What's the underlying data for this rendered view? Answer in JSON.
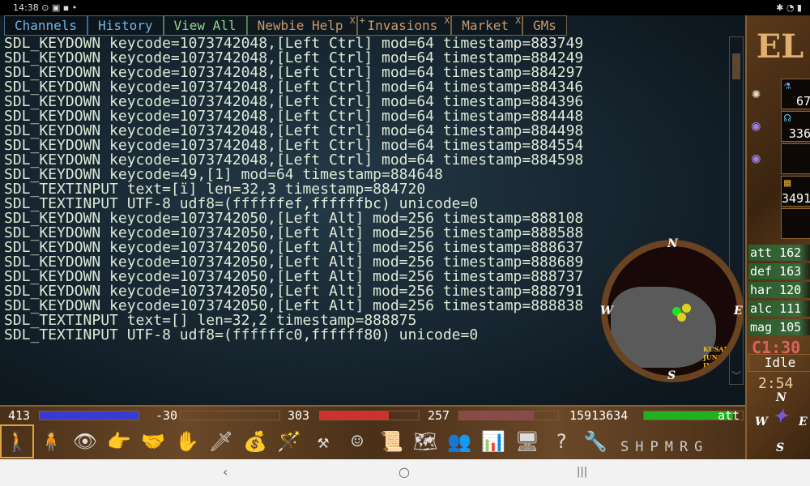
{
  "status_bar": {
    "time": "14:38",
    "icons_left": "⊙ ▣ ▪ •",
    "icons_right": "✱ ◔ ▮"
  },
  "tabs": [
    {
      "label": "Channels",
      "style": "blue"
    },
    {
      "label": "History",
      "style": "blue"
    },
    {
      "label": "View All",
      "style": "green"
    },
    {
      "label": "Newbie Help",
      "close": "X"
    },
    {
      "label": "Invasions",
      "close": "X",
      "plus": "+"
    },
    {
      "label": "Market",
      "close": "X"
    },
    {
      "label": "GMs"
    }
  ],
  "chat_lines": [
    "SDL_KEYDOWN keycode=1073742048,[Left Ctrl] mod=64 timestamp=883749",
    "SDL_KEYDOWN keycode=1073742048,[Left Ctrl] mod=64 timestamp=884249",
    "SDL_KEYDOWN keycode=1073742048,[Left Ctrl] mod=64 timestamp=884297",
    "SDL_KEYDOWN keycode=1073742048,[Left Ctrl] mod=64 timestamp=884346",
    "SDL_KEYDOWN keycode=1073742048,[Left Ctrl] mod=64 timestamp=884396",
    "SDL_KEYDOWN keycode=1073742048,[Left Ctrl] mod=64 timestamp=884448",
    "SDL_KEYDOWN keycode=1073742048,[Left Ctrl] mod=64 timestamp=884498",
    "SDL_KEYDOWN keycode=1073742048,[Left Ctrl] mod=64 timestamp=884554",
    "SDL_KEYDOWN keycode=1073742048,[Left Ctrl] mod=64 timestamp=884598",
    "SDL_KEYDOWN keycode=49,[1] mod=64 timestamp=884648",
    "SDL_TEXTINPUT text=[ï] len=32,3 timestamp=884720",
    "SDL_TEXTINPUT UTF-8 udf8=(ffffffef,ffffffbc) unicode=0",
    "SDL_KEYDOWN keycode=1073742050,[Left Alt] mod=256 timestamp=888108",
    "SDL_KEYDOWN keycode=1073742050,[Left Alt] mod=256 timestamp=888588",
    "SDL_KEYDOWN keycode=1073742050,[Left Alt] mod=256 timestamp=888637",
    "SDL_KEYDOWN keycode=1073742050,[Left Alt] mod=256 timestamp=888689",
    "SDL_KEYDOWN keycode=1073742050,[Left Alt] mod=256 timestamp=888737",
    "SDL_KEYDOWN keycode=1073742050,[Left Alt] mod=256 timestamp=888791",
    "SDL_KEYDOWN keycode=1073742050,[Left Alt] mod=256 timestamp=888838",
    "SDL_TEXTINPUT text=[] len=32,2 timestamp=888875",
    "SDL_TEXTINPUT UTF-8 udf8=(ffffffc0,ffffff80) unicode=0"
  ],
  "minimap": {
    "compass": {
      "n": "N",
      "s": "S",
      "e": "E",
      "w": "W"
    },
    "map_label": "KUSAMU\nJUNGLE\nINSU"
  },
  "side_panel": {
    "logo": "EL",
    "quickbar": [
      {
        "icon": "potion-icon",
        "count": "67"
      },
      {
        "icon": "essence-icon",
        "count": "336"
      },
      {
        "icon": "empty",
        "count": ""
      },
      {
        "icon": "gold-coins-icon",
        "count": "3491"
      },
      {
        "icon": "empty",
        "count": ""
      }
    ],
    "spells": [
      "summon-icon",
      "magic-orb-icon",
      "magic-orb-icon"
    ],
    "skills": [
      {
        "name": "att",
        "value": "162"
      },
      {
        "name": "def",
        "value": "163"
      },
      {
        "name": "har",
        "value": "120"
      },
      {
        "name": "alc",
        "value": "111"
      },
      {
        "name": "mag",
        "value": "105"
      }
    ],
    "server_clock": "C1:30",
    "action": "Idle",
    "time": "2:54",
    "compass": {
      "n": "N",
      "s": "S",
      "e": "E",
      "w": "W"
    }
  },
  "bottom_bar": {
    "stats": [
      {
        "value": "413",
        "color": "#3a3ad0",
        "fill": 1.0
      },
      {
        "value": "-30",
        "color": "#3a3ad0",
        "fill": 0.0
      },
      {
        "value": "303",
        "color": "#d03030",
        "fill": 0.7
      },
      {
        "value": "257",
        "color": "#8a4a4a",
        "fill": 0.75
      },
      {
        "value": "15913634",
        "color": "#20b020",
        "fill": 0.9,
        "label": "att"
      }
    ],
    "icons": [
      {
        "name": "walk-icon",
        "glyph": "🚶"
      },
      {
        "name": "sit-icon",
        "glyph": "🧍"
      },
      {
        "name": "look-icon",
        "glyph": "👁"
      },
      {
        "name": "use-icon",
        "glyph": "👉"
      },
      {
        "name": "trade-icon",
        "glyph": "🤝"
      },
      {
        "name": "attack-hand-icon",
        "glyph": "✋"
      },
      {
        "name": "sword-icon",
        "glyph": "🗡"
      },
      {
        "name": "inventory-bag-icon",
        "glyph": "💰"
      },
      {
        "name": "spells-wand-icon",
        "glyph": "🪄"
      },
      {
        "name": "manufacture-icon",
        "glyph": "⚒"
      },
      {
        "name": "emotes-icon",
        "glyph": "☺"
      },
      {
        "name": "quest-scroll-icon",
        "glyph": "📜"
      },
      {
        "name": "map-icon",
        "glyph": "🗺"
      },
      {
        "name": "buddy-icon",
        "glyph": "👥"
      },
      {
        "name": "stats-icon",
        "glyph": "📊"
      },
      {
        "name": "console-icon",
        "glyph": "🖥"
      },
      {
        "name": "help-icon",
        "glyph": "?"
      },
      {
        "name": "options-icon",
        "glyph": "🔧"
      }
    ],
    "letters": "SHPMRG"
  },
  "nav_bar": {
    "back": "‹",
    "home": "○",
    "recents": "|||"
  }
}
